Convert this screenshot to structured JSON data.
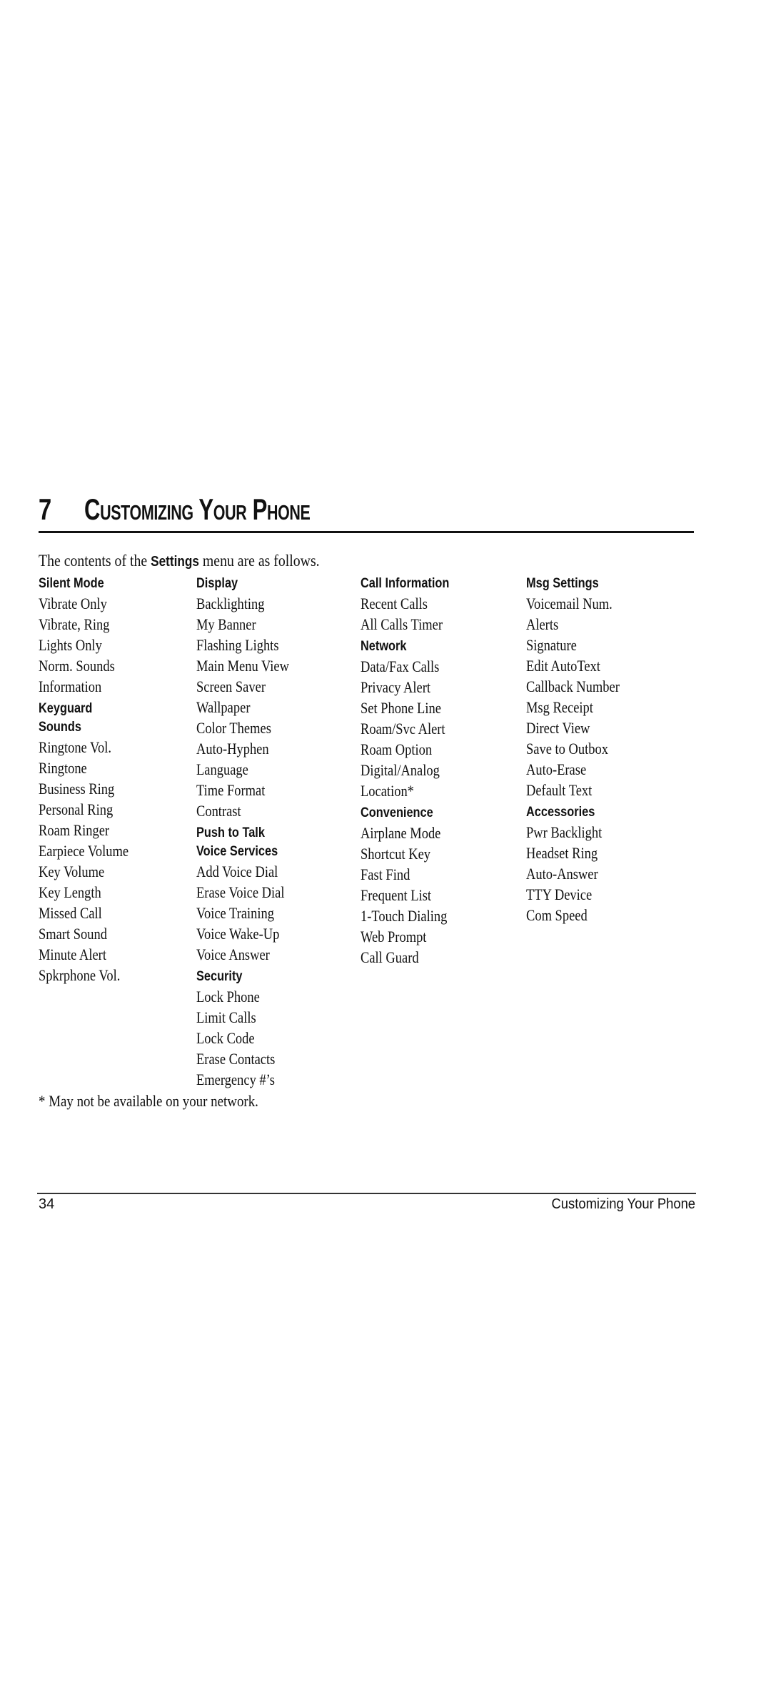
{
  "chapter": {
    "number": "7",
    "title": "Customizing Your Phone"
  },
  "intro": {
    "before": "The contents of the ",
    "emphasis": "Settings",
    "after": " menu are as follows."
  },
  "columns": [
    {
      "groups": [
        {
          "headings": [
            "Silent Mode"
          ],
          "items": [
            "Vibrate Only",
            "Vibrate, Ring",
            "Lights Only",
            "Norm. Sounds",
            "Information"
          ]
        },
        {
          "headings": [
            "Keyguard",
            "Sounds"
          ],
          "items": [
            "Ringtone Vol.",
            "Ringtone",
            "Business Ring",
            "Personal Ring",
            "Roam Ringer",
            "Earpiece Volume",
            "Key Volume",
            "Key Length",
            "Missed Call",
            "Smart Sound",
            "Minute Alert",
            "Spkrphone Vol."
          ]
        }
      ]
    },
    {
      "groups": [
        {
          "headings": [
            "Display"
          ],
          "items": [
            "Backlighting",
            "My Banner",
            "Flashing Lights",
            "Main Menu View",
            "Screen Saver",
            "Wallpaper",
            "Color Themes",
            "Auto-Hyphen",
            "Language",
            "Time Format",
            "Contrast"
          ]
        },
        {
          "headings": [
            "Push to Talk",
            "Voice Services"
          ],
          "items": [
            "Add Voice Dial",
            "Erase Voice Dial",
            "Voice Training",
            "Voice Wake-Up",
            "Voice Answer"
          ]
        },
        {
          "headings": [
            "Security"
          ],
          "items": [
            "Lock Phone",
            "Limit Calls",
            "Lock Code",
            "Erase Contacts",
            "Emergency #’s"
          ]
        }
      ]
    },
    {
      "groups": [
        {
          "headings": [
            "Call Information"
          ],
          "items": [
            "Recent Calls",
            "All Calls Timer"
          ]
        },
        {
          "headings": [
            "Network"
          ],
          "items": [
            "Data/Fax Calls",
            "Privacy Alert",
            "Set Phone Line",
            "Roam/Svc Alert",
            "Roam Option",
            "Digital/Analog",
            "Location*"
          ]
        },
        {
          "headings": [
            "Convenience"
          ],
          "items": [
            "Airplane Mode",
            "Shortcut Key",
            "Fast Find",
            "Frequent List",
            "1-Touch Dialing",
            "Web Prompt",
            "Call Guard"
          ]
        }
      ]
    },
    {
      "groups": [
        {
          "headings": [
            "Msg Settings"
          ],
          "items": [
            "Voicemail Num.",
            "Alerts",
            "Signature",
            "Edit AutoText",
            "Callback Number",
            "Msg Receipt",
            "Direct View",
            "Save to Outbox",
            "Auto-Erase",
            "Default Text"
          ]
        },
        {
          "headings": [
            "Accessories"
          ],
          "items": [
            "Pwr Backlight",
            "Headset Ring",
            "Auto-Answer",
            "TTY Device",
            "Com Speed"
          ]
        }
      ]
    }
  ],
  "footnote": "* May not be available on your network.",
  "footer": {
    "page_number": "34",
    "running_title": "Customizing Your Phone"
  }
}
